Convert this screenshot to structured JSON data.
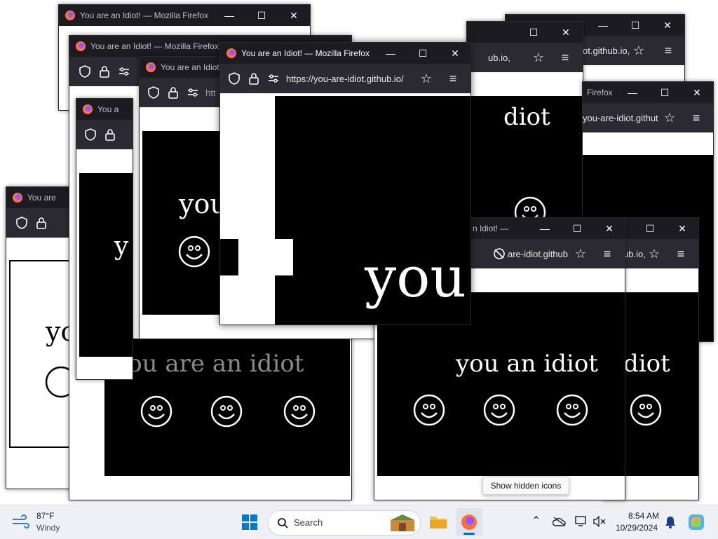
{
  "browser": {
    "window_title": "You are an Idiot! — Mozilla Firefox",
    "window_title_short": "You are an Idiot! —",
    "window_title_partial": "You are an Idiot!",
    "window_title_you": "You are",
    "window_title_you_clipped": "You a",
    "url": "https://you-are-idiot.github.io/",
    "url_tail_1": "ub.io,",
    "url_tail_2": "ot.github.io,",
    "url_tail_3": "you-are-idiot.githut",
    "url_tail_4": "are-idiot.github",
    "url_tail_5": "ub.io,",
    "url_tail_6": "ub.io,",
    "url_partial_htt": "htt",
    "title_firefox": "Firefox",
    "title_idiot_dash": "n Idiot! —",
    "title_efox": "efox"
  },
  "page": {
    "headline": "you are an idiot",
    "headline_alt": "you an idiot",
    "headline_clip": "diot",
    "word_you": "you",
    "word_you_partial": "yo",
    "word_y": "y"
  },
  "window_controls": {
    "minimize": "—",
    "maximize": "☐",
    "close": "✕"
  },
  "taskbar": {
    "weather_temp": "87°F",
    "weather_cond": "Windy",
    "search_placeholder": "Search",
    "time": "8:54 AM",
    "date": "10/29/2024",
    "tooltip_hidden_icons": "Show hidden icons"
  },
  "colors": {
    "titlebar": "#1c1b22",
    "toolbar": "#2b2a33",
    "taskbar": "#eef0f5",
    "accent": "#0067c0"
  }
}
